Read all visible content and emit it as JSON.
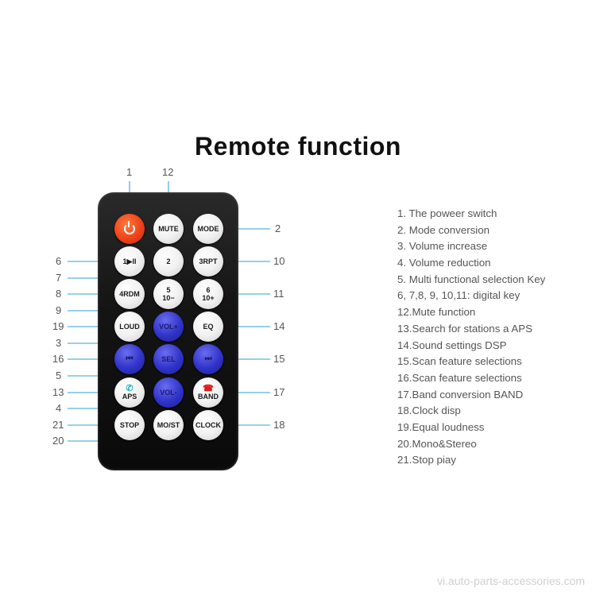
{
  "title": "Remote function",
  "buttons": {
    "power": {
      "label": "",
      "icon": "power-icon"
    },
    "mute": {
      "label": "MUTE"
    },
    "mode": {
      "label": "MODE"
    },
    "b1": {
      "label": "1▶II"
    },
    "b2": {
      "label": "2"
    },
    "b3": {
      "label": "3RPT"
    },
    "b4": {
      "label": "4RDM"
    },
    "b5_top": {
      "label": "5"
    },
    "b5_bottom": {
      "label": "10−"
    },
    "b6_top": {
      "label": "6"
    },
    "b6_bottom": {
      "label": "10+"
    },
    "loud": {
      "label": "LOUD"
    },
    "volup": {
      "label": "VOL+"
    },
    "eq": {
      "label": "EQ"
    },
    "prev": {
      "label": "⏮"
    },
    "sel": {
      "label": "SEL"
    },
    "next": {
      "label": "⏭"
    },
    "aps": {
      "label": "APS",
      "icon": "phone-answer-icon",
      "icon_color": "#2bb5c8"
    },
    "voldown": {
      "label": "VOL-"
    },
    "band": {
      "label": "BAND",
      "icon": "phone-hangup-icon",
      "icon_color": "#e01818"
    },
    "stop": {
      "label": "STOP"
    },
    "most": {
      "label": "MO/ST"
    },
    "clock": {
      "label": "CLOCK"
    }
  },
  "callouts": {
    "n1": "1",
    "n2": "2",
    "n3": "3",
    "n4": "4",
    "n5": "5",
    "n6": "6",
    "n7": "7",
    "n8": "8",
    "n9": "9",
    "n10": "10",
    "n11": "11",
    "n12": "12",
    "n13": "13",
    "n14": "14",
    "n15": "15",
    "n16": "16",
    "n17": "17",
    "n18": "18",
    "n19": "19",
    "n20": "20",
    "n21": "21"
  },
  "legend": [
    "1. The poweer switch",
    "2. Mode conversion",
    "3. Volume increase",
    "4. Volume reduction",
    "5. Multi functional selection Key",
    "6, 7,8, 9, 10,11: digital key",
    "12.Mute function",
    "13.Search for stations a APS",
    "14.Sound settings DSP",
    "15.Scan feature selections",
    "16.Scan feature selections",
    "17.Band conversion BAND",
    "18.Clock disp",
    "19.Equal loudness",
    "20.Mono&Stereo",
    "21.Stop piay"
  ],
  "colors": {
    "callout_line": "#58b4dc",
    "blue_button": "#3033c8",
    "power_button": "#f0421b"
  },
  "watermark": "vi.auto-parts-accessories.com"
}
